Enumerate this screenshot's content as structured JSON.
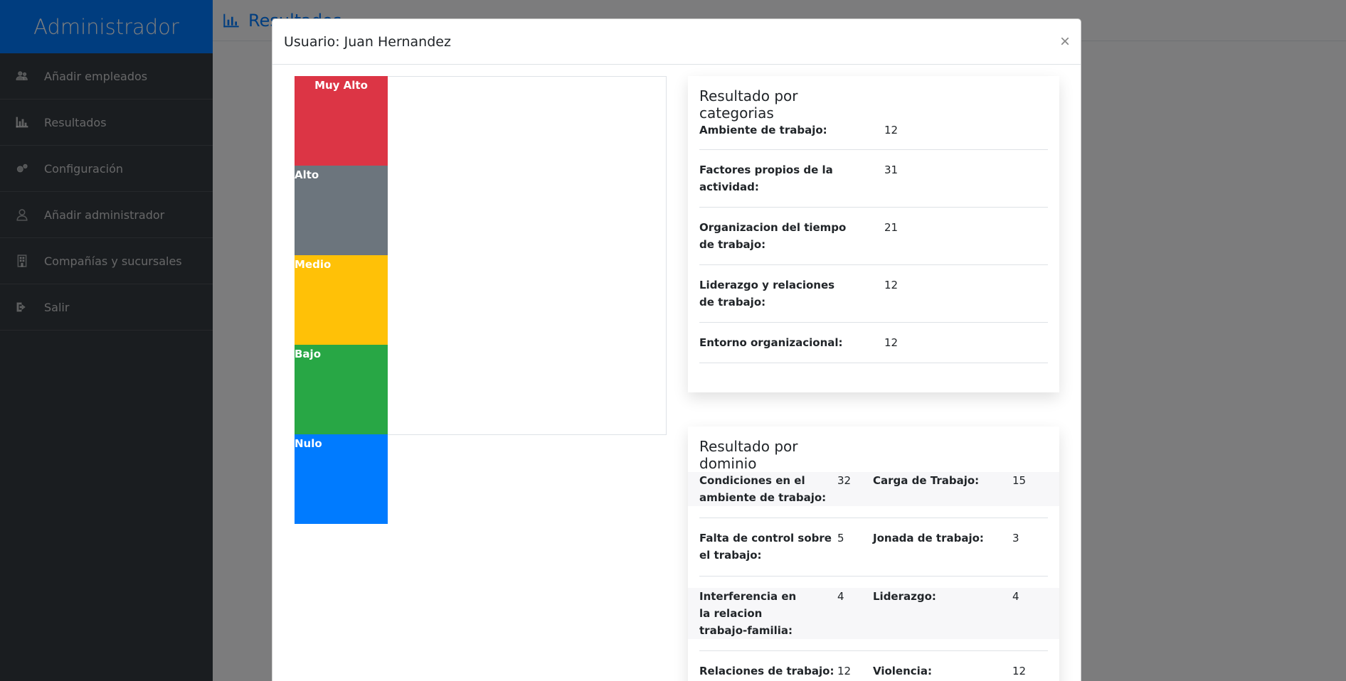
{
  "sidebar": {
    "brand": "Administrador",
    "items": [
      {
        "label": "Añadir empleados",
        "icon": "users-icon"
      },
      {
        "label": "Resultados",
        "icon": "bar-chart-icon"
      },
      {
        "label": "Configuración",
        "icon": "gears-icon"
      },
      {
        "label": "Añadir administrador",
        "icon": "user-icon"
      },
      {
        "label": "Compañías y sucursales",
        "icon": "building-icon"
      },
      {
        "label": "Salir",
        "icon": "sign-out-icon"
      }
    ]
  },
  "page": {
    "title": "Resultados"
  },
  "modal": {
    "title": "Usuario: Juan Hernandez",
    "close_label": "×",
    "levels": [
      {
        "label": "Muy Alto",
        "color": "#dc3545"
      },
      {
        "label": "Alto",
        "color": "#6c757d"
      },
      {
        "label": "Medio",
        "color": "#ffc107"
      },
      {
        "label": "Bajo",
        "color": "#28a745"
      },
      {
        "label": "Nulo",
        "color": "#007bff"
      }
    ],
    "categories": {
      "title": "Resultado por categorias",
      "rows": [
        {
          "label": "Ambiente de trabajo:",
          "value": "12"
        },
        {
          "label": "Factores propios de la actividad:",
          "value": "31"
        },
        {
          "label": "Organizacion del tiempo de trabajo:",
          "value": "21"
        },
        {
          "label": "Liderazgo y relaciones de trabajo:",
          "value": "12"
        },
        {
          "label": "Entorno organizacional:",
          "value": "12"
        }
      ]
    },
    "domains": {
      "title": "Resultado por dominio",
      "rows": [
        [
          {
            "label": "Condiciones en el ambiente de trabajo:",
            "value": "32"
          },
          {
            "label": "Carga de Trabajo:",
            "value": "15"
          }
        ],
        [
          {
            "label": "Falta de control sobre el trabajo:",
            "value": "5"
          },
          {
            "label": "Jonada de trabajo:",
            "value": "3"
          }
        ],
        [
          {
            "label": "Interferencia en la relacion trabajo-familia:",
            "value": "4"
          },
          {
            "label": "Liderazgo:",
            "value": "4"
          }
        ],
        [
          {
            "label": "Relaciones de trabajo:",
            "value": "12"
          },
          {
            "label": "Violencia:",
            "value": "12"
          }
        ]
      ]
    }
  }
}
